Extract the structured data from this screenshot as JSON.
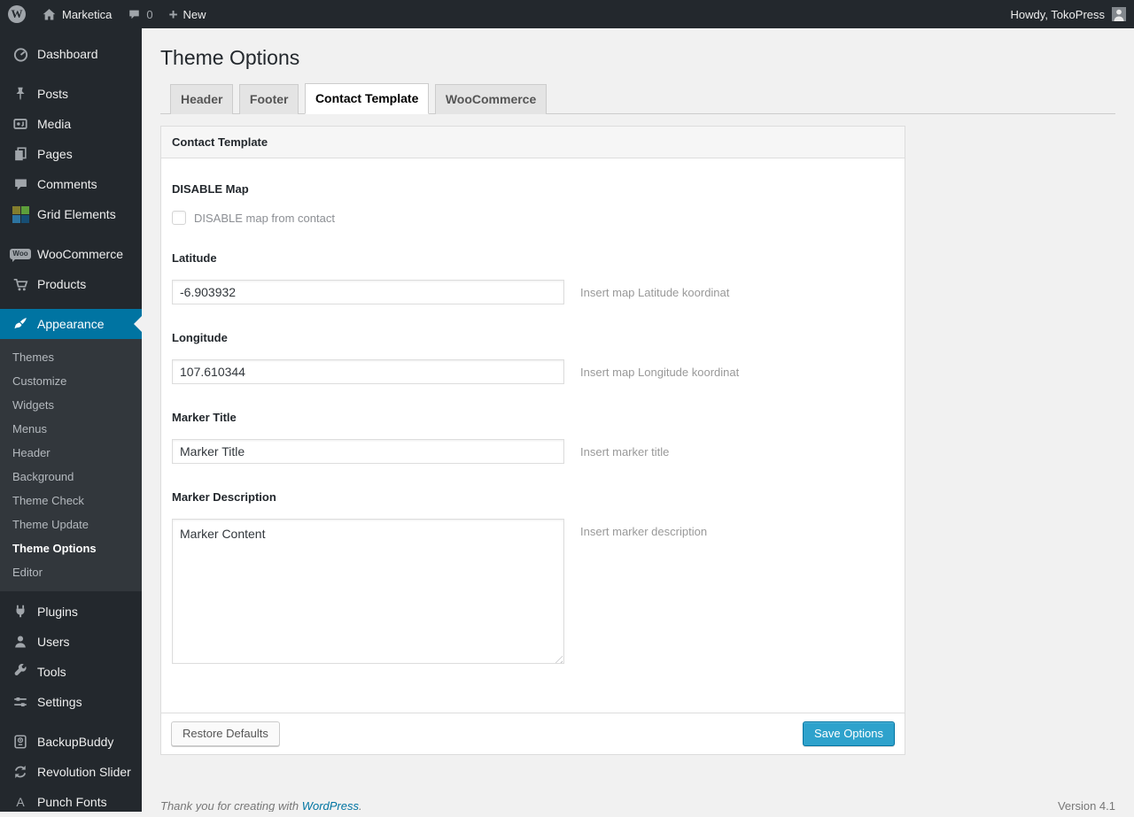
{
  "admin_bar": {
    "site_name": "Marketica",
    "comment_count": "0",
    "new_label": "New",
    "howdy": "Howdy, TokoPress"
  },
  "sidebar": {
    "menu": [
      {
        "label": "Dashboard",
        "icon": "dashboard-icon"
      },
      {
        "label": "Posts",
        "icon": "pushpin-icon"
      },
      {
        "label": "Media",
        "icon": "media-icon"
      },
      {
        "label": "Pages",
        "icon": "pages-icon"
      },
      {
        "label": "Comments",
        "icon": "comment-bubble-icon"
      },
      {
        "label": "Grid Elements",
        "icon": "grid-elements-icon"
      },
      {
        "label": "WooCommerce",
        "icon": "woocommerce-badge-icon"
      },
      {
        "label": "Products",
        "icon": "cart-icon"
      },
      {
        "label": "Appearance",
        "icon": "brush-icon",
        "active": true
      },
      {
        "label": "Plugins",
        "icon": "plug-icon"
      },
      {
        "label": "Users",
        "icon": "user-icon"
      },
      {
        "label": "Tools",
        "icon": "wrench-icon"
      },
      {
        "label": "Settings",
        "icon": "sliders-icon"
      },
      {
        "label": "BackupBuddy",
        "icon": "backup-drive-icon"
      },
      {
        "label": "Revolution Slider",
        "icon": "rotate-arrows-icon"
      },
      {
        "label": "Punch Fonts",
        "icon": "letter-a-icon"
      }
    ],
    "appearance_submenu": {
      "items": [
        "Themes",
        "Customize",
        "Widgets",
        "Menus",
        "Header",
        "Background",
        "Theme Check",
        "Theme Update",
        "Theme Options",
        "Editor"
      ],
      "current": "Theme Options"
    }
  },
  "page": {
    "title": "Theme Options",
    "tabs": [
      {
        "label": "Header",
        "active": false
      },
      {
        "label": "Footer",
        "active": false
      },
      {
        "label": "Contact Template",
        "active": true
      },
      {
        "label": "WooCommerce",
        "active": false
      }
    ],
    "panel_title": "Contact Template",
    "fields": {
      "disable_map": {
        "label": "DISABLE Map",
        "checkbox_label": "DISABLE map from contact",
        "checked": false
      },
      "latitude": {
        "label": "Latitude",
        "value": "-6.903932",
        "hint": "Insert map Latitude koordinat"
      },
      "longitude": {
        "label": "Longitude",
        "value": "107.610344",
        "hint": "Insert map Longitude koordinat"
      },
      "marker_title": {
        "label": "Marker Title",
        "value": "Marker Title",
        "hint": "Insert marker title"
      },
      "marker_description": {
        "label": "Marker Description",
        "value": "Marker Content",
        "hint": "Insert marker description"
      }
    },
    "actions": {
      "restore": "Restore Defaults",
      "save": "Save Options"
    },
    "footer": {
      "thanks": "Thank you for creating with",
      "link": "WordPress",
      "suffix": ".",
      "version": "Version 4.1"
    }
  },
  "colors": {
    "admin_dark": "#23282d",
    "submenu_bg": "#32373c",
    "accent_blue": "#0074a2",
    "primary_button": "#2ea2cc",
    "page_bg": "#f1f1f1"
  }
}
